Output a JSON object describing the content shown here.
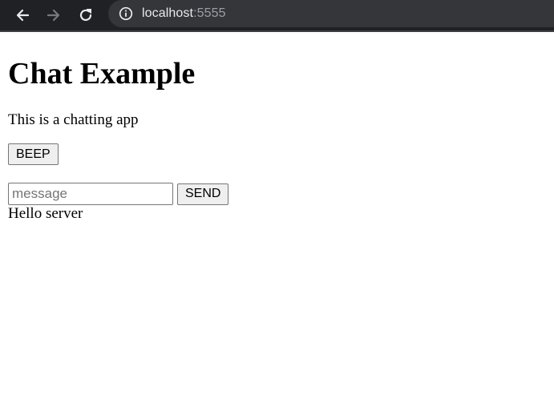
{
  "browser": {
    "url_host": "localhost",
    "url_port": ":5555"
  },
  "page": {
    "heading": "Chat Example",
    "intro": "This is a chatting app",
    "beep_label": "BEEP",
    "message_placeholder": "message",
    "message_value": "",
    "send_label": "SEND",
    "messages": [
      "Hello server"
    ]
  },
  "icons": {
    "back": "back-arrow-icon",
    "forward": "forward-arrow-icon",
    "reload": "reload-icon",
    "info": "info-icon"
  },
  "colors": {
    "toolbar_bg": "#202124",
    "omnibox_bg": "#35363a",
    "url_host": "#e8eaed",
    "url_port": "#9aa0a6"
  }
}
